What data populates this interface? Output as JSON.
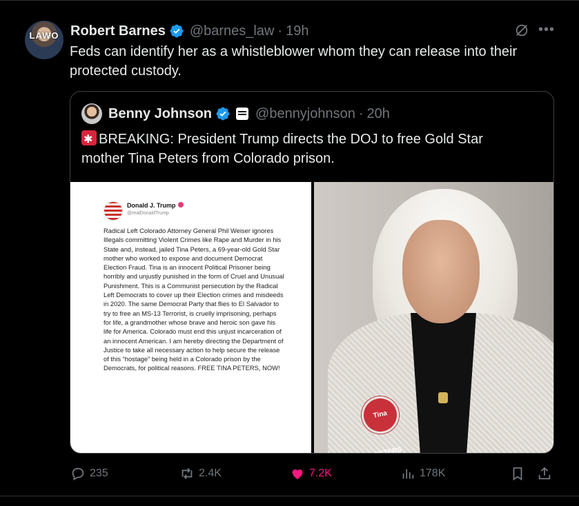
{
  "author": {
    "name": "Robert Barnes",
    "handle": "@barnes_law",
    "time": "19h",
    "avatar_text": "LAWO"
  },
  "tweet_text": "Feds can identify her as a whistleblower whom they can release into their protected custody.",
  "quoted": {
    "name": "Benny Johnson",
    "handle": "@bennyjohnson",
    "time": "20h",
    "text": "BREAKING: President Trump directs the DOJ to free Gold Star mother Tina Peters from Colorado prison.",
    "embedded_post": {
      "name": "Donald J. Trump",
      "handle": "@realDonaldTrump",
      "body": "Radical Left Colorado Attorney General Phil Weiser ignores Illegals committing Violent Crimes like Rape and Murder in his State and, instead, jailed Tina Peters, a 69-year-old Gold Star mother who worked to expose and document Democrat Election Fraud. Tina is an innocent Political Prisoner being horribly and unjustly punished in the form of Cruel and Unusual Punishment. This is a Communist persecution by the Radical Left Democrats to cover up their Election crimes and misdeeds in 2020. The same Democrat Party that flies to El Salvador to try to free an MS-13 Terrorist, is cruelly imprisoning, perhaps for life, a grandmother whose brave and heroic son gave his life for America. Colorado must end this unjust incarceration of an innocent American. I am hereby directing the Department of Justice to take all necessary action to help secure the release of this “hostage” being held in a Colorado prison by the Democrats, for political reasons. FREE TINA PETERS, NOW!"
    },
    "photo_pin_text": "Tina PETERS"
  },
  "actions": {
    "replies": "235",
    "reposts": "2.4K",
    "likes": "7.2K",
    "views": "178K"
  },
  "separator": "·",
  "colors": {
    "background": "#000000",
    "text": "#e7e9ea",
    "muted": "#71767b",
    "verified": "#1d9bf0",
    "like": "#f91880",
    "border": "#3e4144"
  },
  "icons": [
    "verified-badge-icon",
    "grok-icon",
    "more-icon",
    "reply-icon",
    "repost-icon",
    "like-icon",
    "views-icon",
    "bookmark-icon",
    "share-icon",
    "siren-icon"
  ]
}
